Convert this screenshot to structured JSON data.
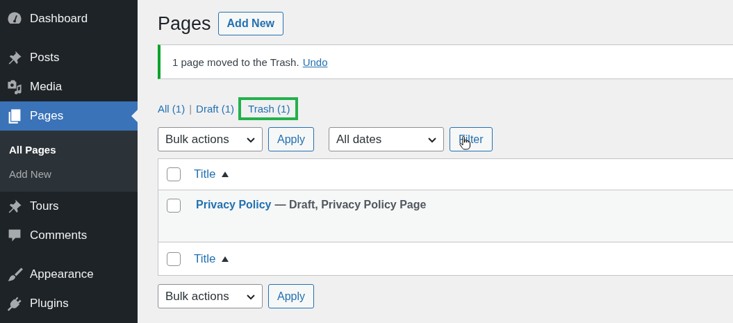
{
  "sidebar": {
    "groups": [
      {
        "items": [
          {
            "label": "Dashboard",
            "selected": false
          }
        ]
      },
      {
        "items": [
          {
            "label": "Posts",
            "selected": false
          },
          {
            "label": "Media",
            "selected": false
          },
          {
            "label": "Pages",
            "selected": true,
            "submenu": [
              {
                "label": "All Pages",
                "selected": true
              },
              {
                "label": "Add New",
                "selected": false
              }
            ]
          },
          {
            "label": "Tours",
            "selected": false
          },
          {
            "label": "Comments",
            "selected": false
          }
        ]
      },
      {
        "items": [
          {
            "label": "Appearance",
            "selected": false
          },
          {
            "label": "Plugins",
            "selected": false
          }
        ]
      }
    ]
  },
  "header": {
    "title": "Pages",
    "add_button": "Add New"
  },
  "notice": {
    "message": "1 page moved to the Trash.",
    "link": "Undo"
  },
  "views": [
    {
      "label": "All",
      "count": "(1)",
      "highlighted": false
    },
    {
      "label": "Draft",
      "count": "(1)",
      "highlighted": false,
      "separator_before": "|"
    },
    {
      "label": "Trash",
      "count": "(1)",
      "highlighted": true
    }
  ],
  "top_actions": {
    "bulk": "Bulk actions",
    "apply": "Apply",
    "dates": "All dates",
    "filter": "Filter"
  },
  "table": {
    "header": {
      "title": "Title",
      "checked": false
    },
    "rows": [
      {
        "title": "Privacy Policy",
        "state": "— Draft, Privacy Policy Page",
        "checked": false
      }
    ],
    "footer": {
      "title": "Title",
      "checked": false
    }
  },
  "bottom_actions": {
    "bulk": "Bulk actions",
    "apply": "Apply"
  }
}
